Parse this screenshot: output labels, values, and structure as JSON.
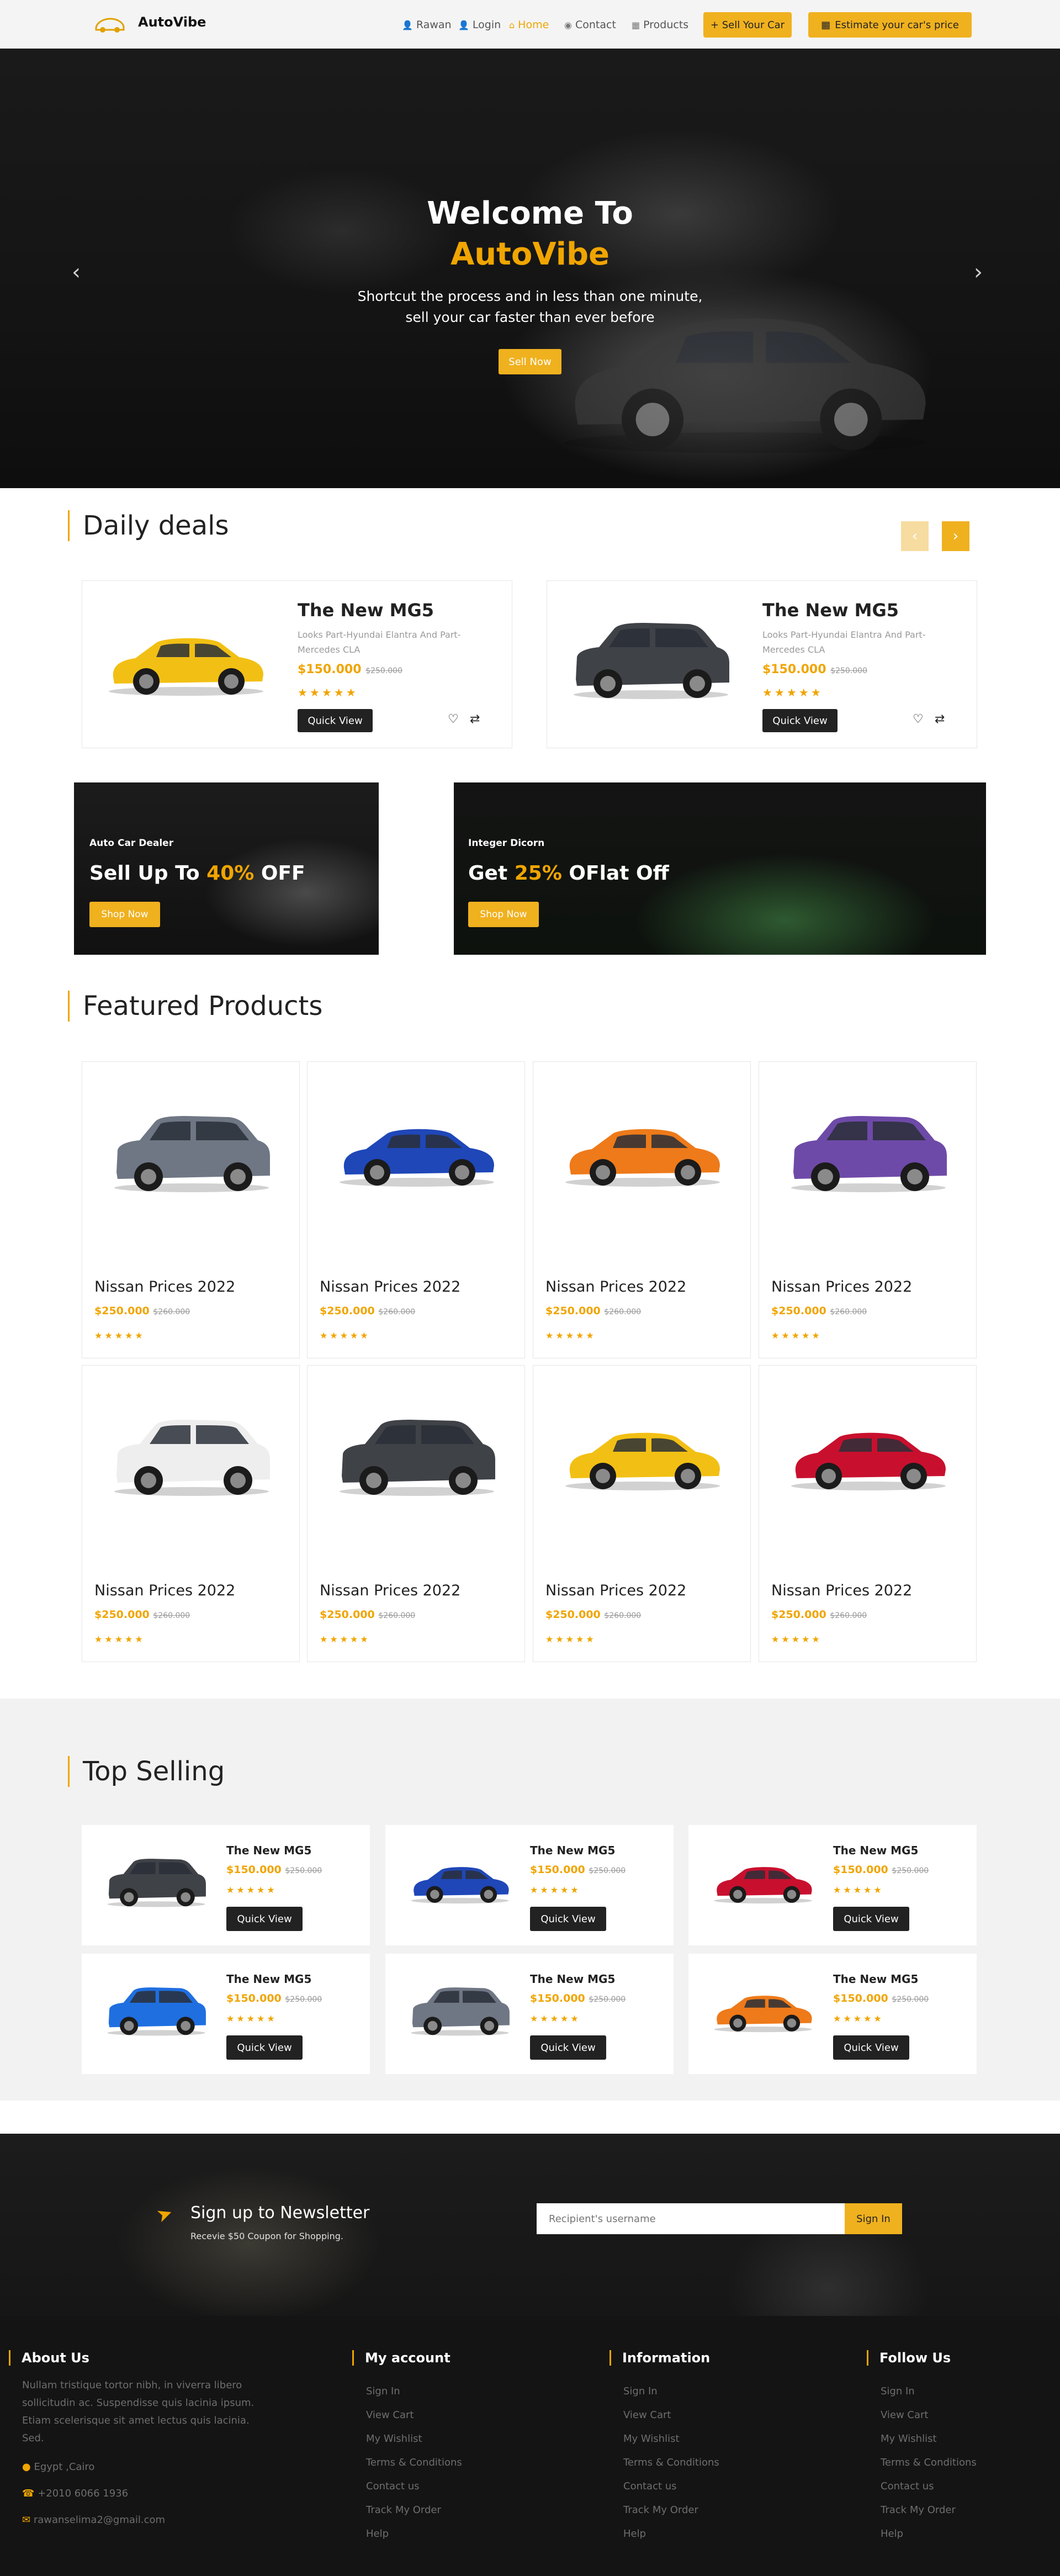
{
  "header": {
    "brand": "AutoVibe",
    "nav": [
      {
        "icon": "user-icon",
        "label": "Rawan"
      },
      {
        "icon": "user-icon",
        "label": "Login"
      },
      {
        "icon": "home-icon",
        "label": "Home",
        "active": true
      },
      {
        "icon": "eye-icon",
        "label": "Contact"
      },
      {
        "icon": "grid-icon",
        "label": "Products"
      }
    ],
    "sell_btn": "+ Sell Your Car",
    "estimate_btn": "Estimate your car's price",
    "accent": "#f0b11f"
  },
  "hero": {
    "title_line1": "Welcome To",
    "title_line2": "AutoVibe",
    "subtitle_line1": "Shortcut the process and in less than one minute,",
    "subtitle_line2": "sell your car faster than ever before",
    "button": "Sell Now"
  },
  "daily_deals": {
    "title": "Daily deals",
    "items": [
      {
        "name": "The New MG5",
        "desc": "Looks Part-Hyundai Elantra And Part-Mercedes CLA",
        "price": "$150.000",
        "old_price": "$250.000",
        "stars": "★★★★★",
        "button": "Quick View",
        "car": "yellow-sedan"
      },
      {
        "name": "The New MG5",
        "desc": "Looks Part-Hyundai Elantra And Part-Mercedes CLA",
        "price": "$150.000",
        "old_price": "$250.000",
        "stars": "★★★★★",
        "button": "Quick View",
        "car": "grey-suv"
      }
    ]
  },
  "promos": [
    {
      "tag": "Auto Car Dealer",
      "head_pre": "Sell Up To ",
      "head_hl": "40%",
      "head_post": " OFF",
      "button": "Shop Now"
    },
    {
      "tag": "Integer Dicorn",
      "head_pre": "Get ",
      "head_hl": "25%",
      "head_post": " OFlat Off",
      "button": "Shop Now"
    }
  ],
  "featured": {
    "title": "Featured Products",
    "items": [
      {
        "name": "Nissan Prices 2022",
        "price": "$250.000",
        "old_price": "$260.000",
        "stars": "★★★★★",
        "car": "grey-crossover"
      },
      {
        "name": "Nissan Prices 2022",
        "price": "$250.000",
        "old_price": "$260.000",
        "stars": "★★★★★",
        "car": "blue-gtr"
      },
      {
        "name": "Nissan Prices 2022",
        "price": "$250.000",
        "old_price": "$260.000",
        "stars": "★★★★★",
        "car": "orange-sedan"
      },
      {
        "name": "Nissan Prices 2022",
        "price": "$250.000",
        "old_price": "$260.000",
        "stars": "★★★★★",
        "car": "purple-suv"
      },
      {
        "name": "Nissan Prices 2022",
        "price": "$250.000",
        "old_price": "$260.000",
        "stars": "★★★★★",
        "car": "white-hatch"
      },
      {
        "name": "Nissan Prices 2022",
        "price": "$250.000",
        "old_price": "$260.000",
        "stars": "★★★★★",
        "car": "grey-suv"
      },
      {
        "name": "Nissan Prices 2022",
        "price": "$250.000",
        "old_price": "$260.000",
        "stars": "★★★★★",
        "car": "yellow-sedan"
      },
      {
        "name": "Nissan Prices 2022",
        "price": "$250.000",
        "old_price": "$260.000",
        "stars": "★★★★★",
        "car": "red-roadster"
      }
    ]
  },
  "top_selling": {
    "title": "Top Selling",
    "items": [
      {
        "name": "The New MG5",
        "price": "$150.000",
        "old_price": "$250.000",
        "stars": "★★★★★",
        "button": "Quick View",
        "car": "grey-suv"
      },
      {
        "name": "The New MG5",
        "price": "$150.000",
        "old_price": "$250.000",
        "stars": "★★★★★",
        "button": "Quick View",
        "car": "blue-gtr"
      },
      {
        "name": "The New MG5",
        "price": "$150.000",
        "old_price": "$250.000",
        "stars": "★★★★★",
        "button": "Quick View",
        "car": "red-roadster"
      },
      {
        "name": "The New MG5",
        "price": "$150.000",
        "old_price": "$250.000",
        "stars": "★★★★★",
        "button": "Quick View",
        "car": "blue-hatch"
      },
      {
        "name": "The New MG5",
        "price": "$150.000",
        "old_price": "$250.000",
        "stars": "★★★★★",
        "button": "Quick View",
        "car": "grey-crossover"
      },
      {
        "name": "The New MG5",
        "price": "$150.000",
        "old_price": "$250.000",
        "stars": "★★★★★",
        "button": "Quick View",
        "car": "orange-sedan"
      }
    ]
  },
  "newsletter": {
    "title": "Sign up to Newsletter",
    "subtitle": "Recevie $50 Coupon for Shopping.",
    "placeholder": "Recipient's username",
    "button": "Sign In"
  },
  "footer": {
    "about": {
      "title": "About Us",
      "text": "Nullam tristique tortor nibh, in viverra libero sollicitudin ac. Suspendisse quis lacinia ipsum. Etiam scelerisque sit amet lectus quis lacinia. Sed.",
      "location": "Egypt ,Cairo",
      "phone": "+2010 6066 1936",
      "email": "rawanselima2@gmail.com"
    },
    "columns": [
      {
        "title": "My account",
        "links": [
          "Sign In",
          "View Cart",
          "My Wishlist",
          "Terms & Conditions",
          "Contact us",
          "Track My Order",
          "Help"
        ]
      },
      {
        "title": "Information",
        "links": [
          "Sign In",
          "View Cart",
          "My Wishlist",
          "Terms & Conditions",
          "Contact us",
          "Track My Order",
          "Help"
        ]
      },
      {
        "title": "Follow Us",
        "links": [
          "Sign In",
          "View Cart",
          "My Wishlist",
          "Terms & Conditions",
          "Contact us",
          "Track My Order",
          "Help"
        ]
      }
    ]
  }
}
